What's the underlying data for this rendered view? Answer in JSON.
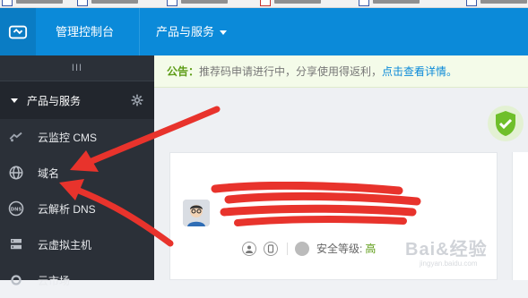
{
  "topbar": {
    "console_label": "管理控制台",
    "products_label": "产品与服务",
    "logo_icon": "cloud-logo-icon"
  },
  "sidebar": {
    "collapse_label": "III",
    "section_label": "产品与服务",
    "items": [
      {
        "label": "云监控 CMS",
        "icon": "monitor-icon"
      },
      {
        "label": "域名",
        "icon": "globe-icon"
      },
      {
        "label": "云解析 DNS",
        "icon": "dns-icon"
      },
      {
        "label": "云虚拟主机",
        "icon": "server-icon"
      },
      {
        "label": "云市场",
        "icon": "market-icon"
      }
    ]
  },
  "notice": {
    "label": "公告：",
    "body": "推荐码申请进行中，分享使用得返利，",
    "link": "点击查看详情。"
  },
  "account": {
    "security_label": "安全等级:",
    "security_level": "高"
  },
  "watermark": {
    "brand": "Bai&经验",
    "url": "jingyan.baidu.com"
  },
  "colors": {
    "topbar": "#0b8ad9",
    "sidebar": "#2b3038",
    "accent_green": "#5d9c16",
    "annotation_red": "#e8332c"
  }
}
